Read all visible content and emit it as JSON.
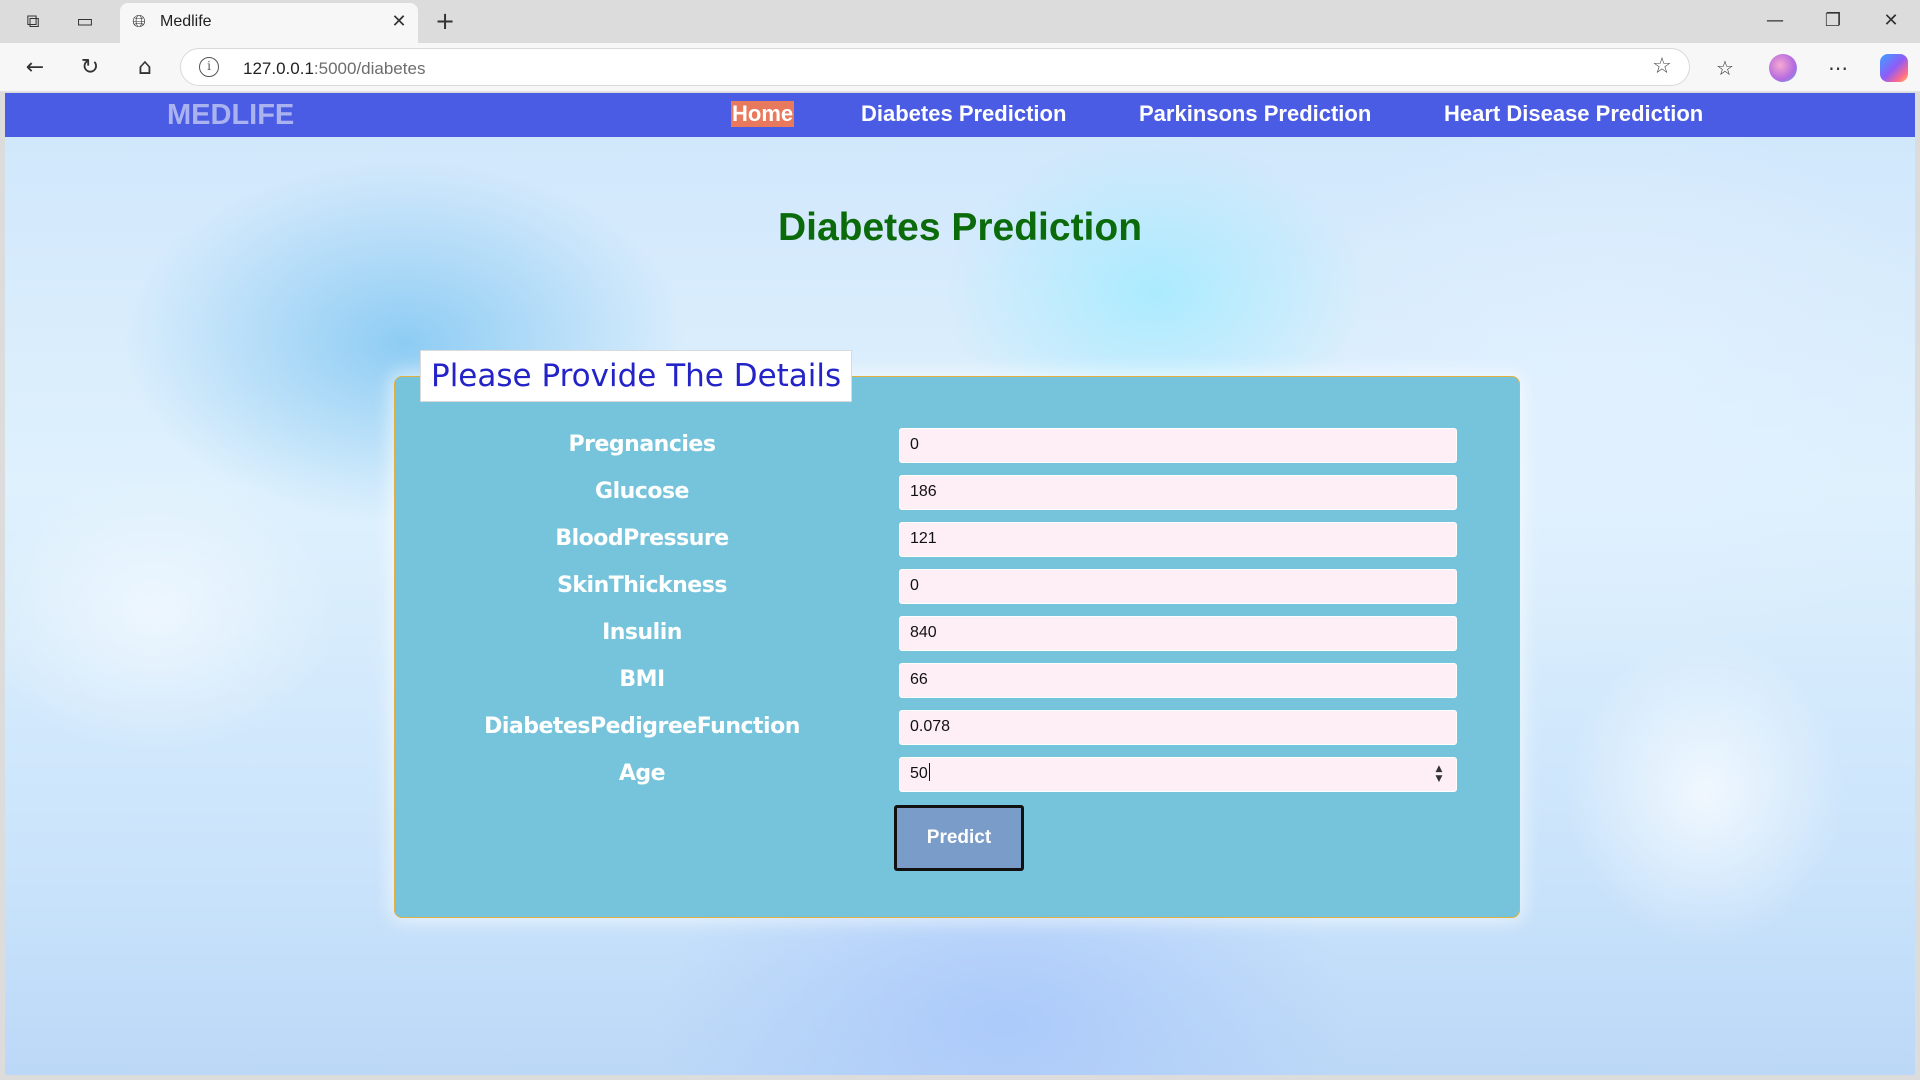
{
  "browser": {
    "tab_title": "Medlife",
    "url_host": "127.0.0.1",
    "url_path": ":5000/diabetes"
  },
  "navbar": {
    "brand": "MEDLIFE",
    "links": [
      {
        "label": "Home",
        "active": true
      },
      {
        "label": "Diabetes Prediction",
        "active": false
      },
      {
        "label": "Parkinsons Prediction",
        "active": false
      },
      {
        "label": "Heart Disease Prediction",
        "active": false
      }
    ]
  },
  "page": {
    "title": "Diabetes Prediction"
  },
  "form": {
    "legend": "Please Provide The Details",
    "fields": [
      {
        "label": "Pregnancies",
        "value": "0"
      },
      {
        "label": "Glucose",
        "value": "186"
      },
      {
        "label": "BloodPressure",
        "value": "121"
      },
      {
        "label": "SkinThickness",
        "value": "0"
      },
      {
        "label": "Insulin",
        "value": "840"
      },
      {
        "label": "BMI",
        "value": "66"
      },
      {
        "label": "DiabetesPedigreeFunction",
        "value": "0.078"
      },
      {
        "label": "Age",
        "value": "50"
      }
    ],
    "submit_label": "Predict"
  },
  "colors": {
    "navbar": "#4b5ce4",
    "active_link": "#e8795c",
    "title": "#0b6b0b",
    "panel": "#76c4db",
    "legend_text": "#2323c8",
    "input_bg": "#feeef6",
    "button": "#7a9cc9"
  },
  "icons": [
    "workspaces-icon",
    "tab-actions-icon",
    "globe-icon",
    "close-icon",
    "new-tab-icon",
    "minimize-icon",
    "restore-icon",
    "window-close-icon",
    "back-icon",
    "reload-icon",
    "home-icon",
    "info-icon",
    "favorite-star-icon",
    "favorites-icon",
    "profile-icon",
    "more-icon",
    "copilot-icon",
    "spinner-icon"
  ]
}
